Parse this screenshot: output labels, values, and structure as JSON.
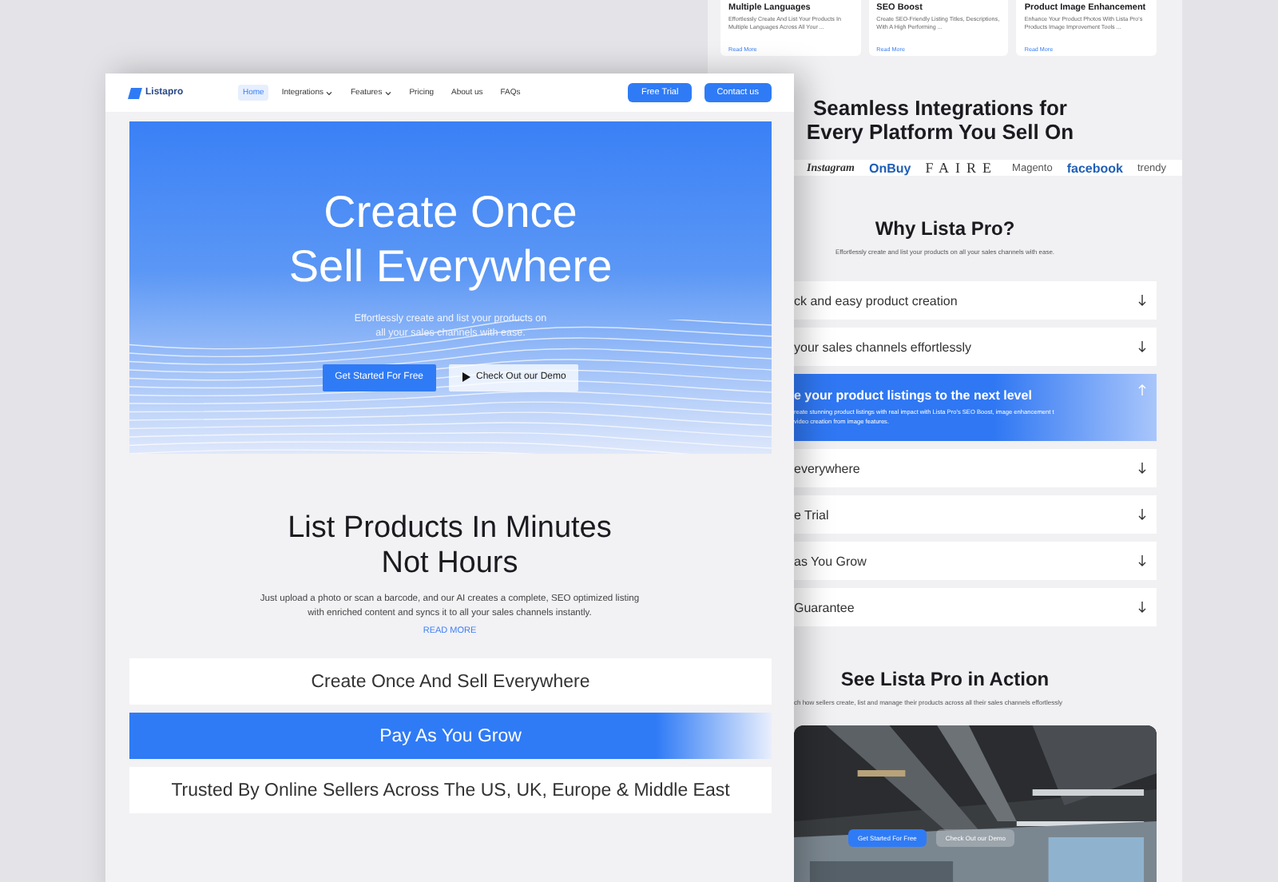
{
  "front_page": {
    "logo": {
      "text": "Listapro"
    },
    "nav": [
      {
        "label": "Home",
        "selected": true,
        "dropdown": false
      },
      {
        "label": "Integrations",
        "selected": false,
        "dropdown": true
      },
      {
        "label": "Features",
        "selected": false,
        "dropdown": true
      },
      {
        "label": "Pricing",
        "selected": false,
        "dropdown": false
      },
      {
        "label": "About us",
        "selected": false,
        "dropdown": false
      },
      {
        "label": "FAQs",
        "selected": false,
        "dropdown": false
      }
    ],
    "nav_buttons": [
      "Free Trial",
      "Contact us"
    ],
    "hero": {
      "title": "Create Once Sell Everywhere",
      "subtitle": "Effortlessly create and list your products on all your sales channels with ease.",
      "primary_button": "Get Started For Free",
      "demo_button": "Check Out our Demo"
    },
    "section": {
      "title": "List Products In Minutes Not Hours",
      "text": "Just upload a photo or scan a barcode, and our AI creates a complete, SEO optimized listing with enriched content and syncs it to all your sales channels instantly.",
      "link": "READ MORE"
    },
    "bars": [
      {
        "label": "Create Once And Sell Everywhere",
        "selected": false
      },
      {
        "label": "Pay As You Grow",
        "selected": true
      },
      {
        "label": "Trusted By Online Sellers Across The US, UK, Europe & Middle East",
        "selected": false
      }
    ]
  },
  "back_page": {
    "cards": [
      {
        "title": "Multiple Languages",
        "text": "Effortlessly Create And List Your Products In Multiple Languages Across All Your ...",
        "link": "Read More"
      },
      {
        "title": "SEO Boost",
        "text": "Create SEO-Friendly Listing Titles, Descriptions, With A High Performing ...",
        "link": "Read More"
      },
      {
        "title": "Product Image Enhancement",
        "text": "Enhance Your Product Photos With Lista Pro's Products Image Improvement Tools ...",
        "link": "Read More"
      }
    ],
    "integrations_title": "Seamless Integrations for Every Platform You Sell On",
    "logos": [
      {
        "text": "Instagram",
        "kind": "script"
      },
      {
        "text": "OnBuy",
        "kind": "bold"
      },
      {
        "text": "FAIRE",
        "kind": "serif"
      },
      {
        "text": "Magento",
        "kind": "plain"
      },
      {
        "text": "facebook",
        "kind": "bold"
      },
      {
        "text": "trendy",
        "kind": "plain"
      }
    ],
    "why_title": "Why Lista Pro?",
    "why_subtitle": "Effortlessly create and list your products on all your sales channels with ease.",
    "faq": [
      {
        "title": "ck and easy product creation",
        "expanded": false
      },
      {
        "title": "your sales channels effortlessly",
        "expanded": false
      },
      {
        "title": "e your product listings to the next level",
        "expanded": true,
        "body": "reate stunning product listings with real impact with Lista Pro's SEO Boost, image enhancement t video creation from image features."
      },
      {
        "title": "everywhere",
        "expanded": false
      },
      {
        "title": "e Trial",
        "expanded": false
      },
      {
        "title": "as You Grow",
        "expanded": false
      },
      {
        "title": "Guarantee",
        "expanded": false
      }
    ],
    "action_title": "See Lista Pro in Action",
    "action_subtitle": "ch how sellers create, list and manage their products across all their sales channels effortlessly",
    "video": {
      "kind": "picture",
      "primary_button": "Get Started For Free",
      "demo_button": "Check Out our Demo"
    }
  }
}
